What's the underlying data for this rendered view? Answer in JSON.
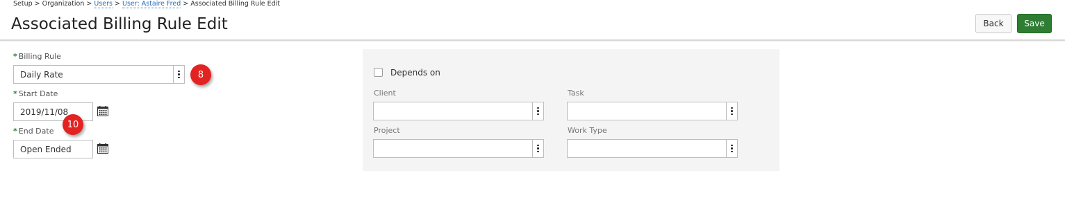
{
  "breadcrumb": {
    "setup": "Setup",
    "sep1": " > ",
    "organization": "Organization",
    "sep2": " > ",
    "users": "Users",
    "sep3": " > ",
    "user": "User: Astaire Fred",
    "sep4": " > ",
    "current": "Associated Billing Rule Edit"
  },
  "page": {
    "title": "Associated Billing Rule Edit"
  },
  "toolbar": {
    "back_label": "Back",
    "save_label": "Save"
  },
  "form": {
    "required_marker": "*",
    "billing_rule": {
      "label": "Billing Rule",
      "value": "Daily Rate"
    },
    "start_date": {
      "label": "Start Date",
      "value": "2019/11/08"
    },
    "end_date": {
      "label": "End Date",
      "value": "Open Ended"
    }
  },
  "annotations": {
    "badge_8": "8",
    "badge_10": "10"
  },
  "depends_panel": {
    "checkbox_label": "Depends on",
    "checked": false,
    "client": {
      "label": "Client",
      "value": ""
    },
    "task": {
      "label": "Task",
      "value": ""
    },
    "project": {
      "label": "Project",
      "value": ""
    },
    "work_type": {
      "label": "Work Type",
      "value": ""
    }
  },
  "colors": {
    "save_button": "#2e7d32",
    "required_marker": "#2e7d32",
    "link": "#2a6ebb",
    "badge": "#e32222",
    "panel_background": "#f4f4f4"
  },
  "icons": {
    "calendar": "calendar-icon",
    "more": "more-vertical-icon"
  }
}
